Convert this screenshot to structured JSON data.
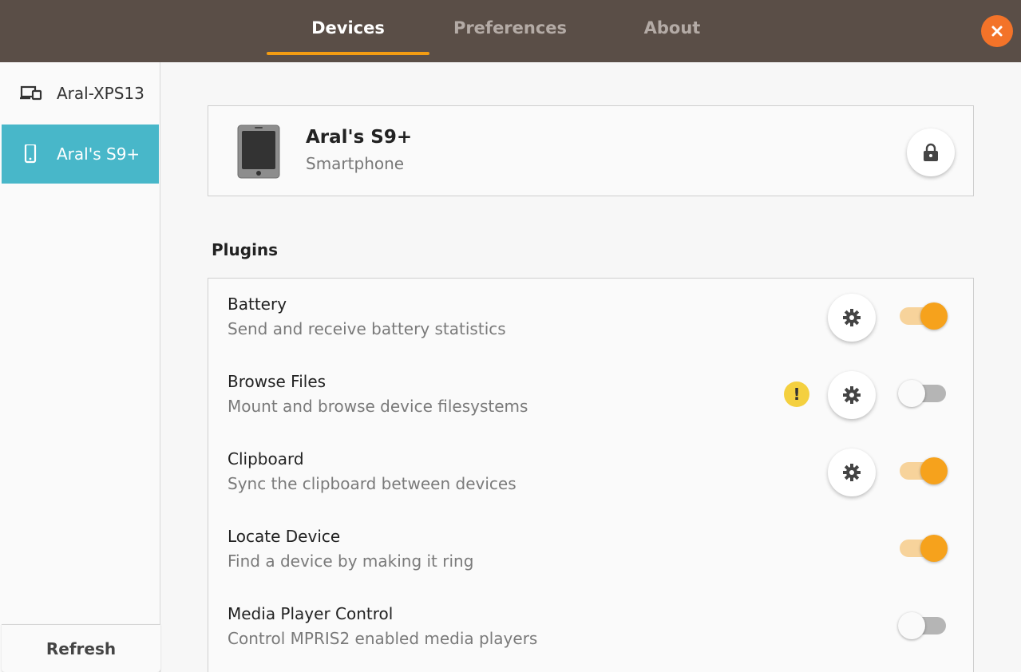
{
  "header": {
    "tabs": [
      {
        "label": "Devices",
        "active": true
      },
      {
        "label": "Preferences",
        "active": false
      },
      {
        "label": "About",
        "active": false
      }
    ],
    "close_icon": "close-icon"
  },
  "sidebar": {
    "items": [
      {
        "label": "Aral-XPS13",
        "icon": "laptop-phone-icon",
        "selected": false
      },
      {
        "label": "Aral's S9+",
        "icon": "smartphone-icon",
        "selected": true
      }
    ],
    "refresh_label": "Refresh"
  },
  "device": {
    "name": "Aral's S9+",
    "type": "Smartphone",
    "icon": "tablet-device-icon",
    "lock_icon": "lock-icon"
  },
  "plugins_title": "Plugins",
  "plugins": [
    {
      "name": "Battery",
      "description": "Send and receive battery statistics",
      "settings": true,
      "warning": false,
      "enabled": true
    },
    {
      "name": "Browse Files",
      "description": "Mount and browse device filesystems",
      "settings": true,
      "warning": true,
      "enabled": false
    },
    {
      "name": "Clipboard",
      "description": "Sync the clipboard between devices",
      "settings": true,
      "warning": false,
      "enabled": true
    },
    {
      "name": "Locate Device",
      "description": "Find a device by making it ring",
      "settings": false,
      "warning": false,
      "enabled": true
    },
    {
      "name": "Media Player Control",
      "description": "Control MPRIS2 enabled media players",
      "settings": false,
      "warning": false,
      "enabled": false
    }
  ],
  "colors": {
    "header_bg": "#5a4e47",
    "accent": "#f39c12",
    "selection": "#48b7c9",
    "close": "#f37329"
  }
}
